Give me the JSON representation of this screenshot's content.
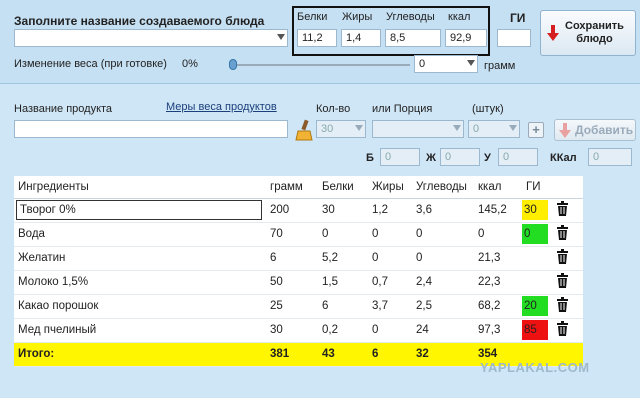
{
  "dish": {
    "title": "Заполните название создаваемого блюда",
    "name_value": "",
    "weight_change_label": "Изменение веса (при готовке)",
    "weight_change_percent": "0%",
    "weight_value": "0",
    "weight_unit": "грамм"
  },
  "macros": {
    "proteins_label": "Белки",
    "fats_label": "Жиры",
    "carbs_label": "Углеводы",
    "kcal_label": "ккал",
    "gi_label": "ГИ",
    "proteins": "11,2",
    "fats": "1,4",
    "carbs": "8,5",
    "kcal": "92,9",
    "gi": ""
  },
  "save_button": {
    "line1": "Сохранить",
    "line2": "блюдо"
  },
  "product": {
    "name_label": "Название продукта",
    "measures_link": "Меры веса продуктов",
    "qty_label": "Кол-во",
    "portion_label": "или Порция",
    "pcs_label": "(штук)",
    "qty_value": "30",
    "portion_value": "",
    "pcs_value": "0",
    "add_button": "Добавить",
    "b_label": "Б",
    "zh_label": "Ж",
    "u_label": "У",
    "kcal_label": "ККал",
    "b_value": "0",
    "zh_value": "0",
    "u_value": "0",
    "kcal_value": "0"
  },
  "table": {
    "headers": [
      "Ингредиенты",
      "грамм",
      "Белки",
      "Жиры",
      "Углеводы",
      "ккал",
      "ГИ"
    ],
    "rows": [
      {
        "name": "Творог 0%",
        "gram": "200",
        "prot": "30",
        "fat": "1,2",
        "carb": "3,6",
        "kcal": "145,2",
        "gi": "30"
      },
      {
        "name": "Вода",
        "gram": "70",
        "prot": "0",
        "fat": "0",
        "carb": "0",
        "kcal": "0",
        "gi": "0"
      },
      {
        "name": "Желатин",
        "gram": "6",
        "prot": "5,2",
        "fat": "0",
        "carb": "0",
        "kcal": "21,3",
        "gi": ""
      },
      {
        "name": "Молоко 1,5%",
        "gram": "50",
        "prot": "1,5",
        "fat": "0,7",
        "carb": "2,4",
        "kcal": "22,3",
        "gi": ""
      },
      {
        "name": "Какао порошок",
        "gram": "25",
        "prot": "6",
        "fat": "3,7",
        "carb": "2,5",
        "kcal": "68,2",
        "gi": "20"
      },
      {
        "name": "Мед пчелиный",
        "gram": "30",
        "prot": "0,2",
        "fat": "0",
        "carb": "24",
        "kcal": "97,3",
        "gi": "85"
      }
    ],
    "total": {
      "name": "Итого:",
      "gram": "381",
      "prot": "43",
      "fat": "6",
      "carb": "32",
      "kcal": "354"
    }
  },
  "gi_colors": {
    "30": "#ffee00",
    "0": "#22dd22",
    "20": "#22dd22",
    "85": "#ee1111"
  },
  "watermark": "YAPLAKAL.COM"
}
